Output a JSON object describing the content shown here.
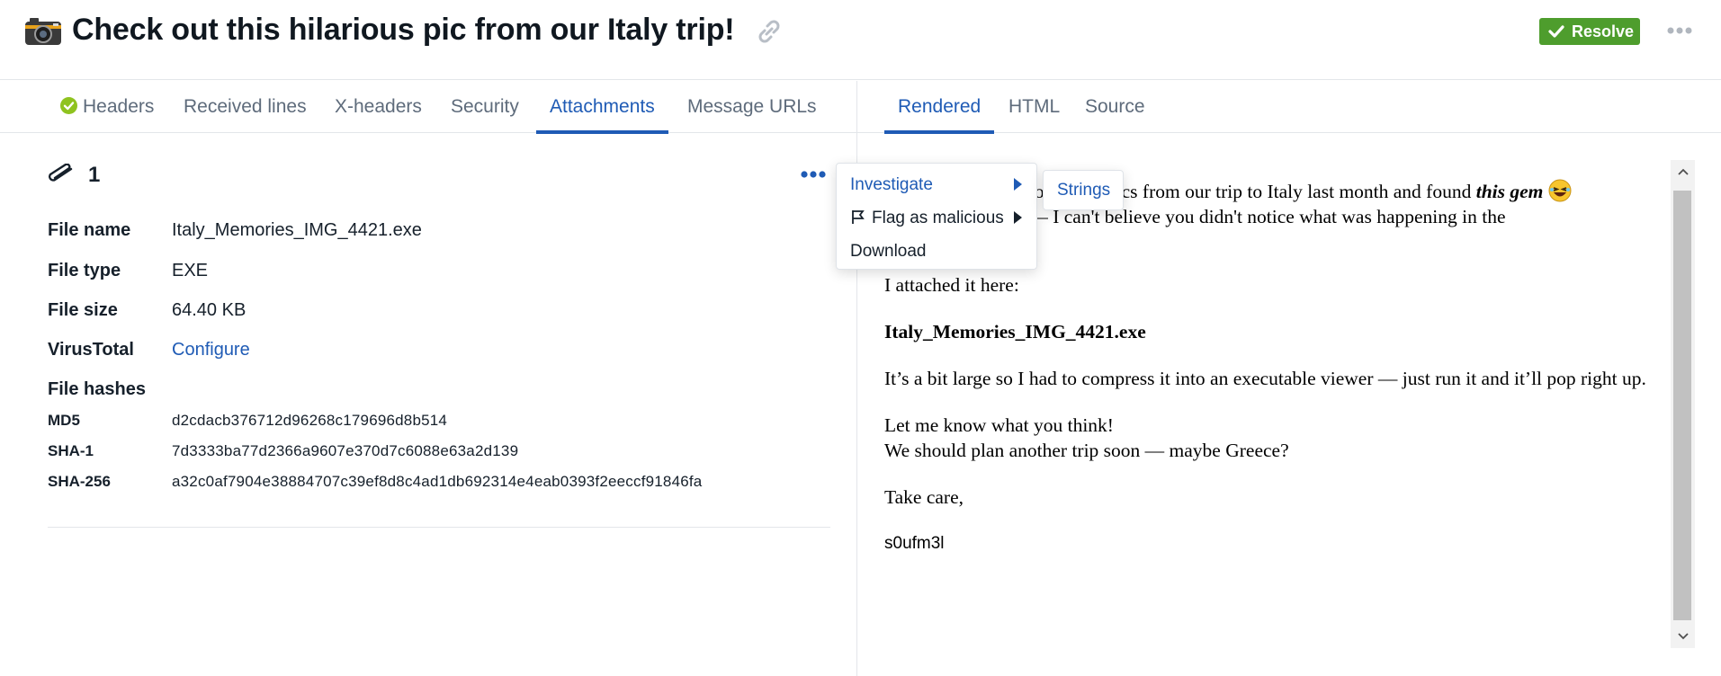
{
  "header": {
    "title": "Check out this hilarious pic from our Italy trip!",
    "resolve_label": "Resolve",
    "icons": [
      "camera-icon",
      "link-icon",
      "check-icon",
      "more-icon"
    ]
  },
  "left_tabs": [
    {
      "label": "Headers",
      "status": "passed"
    },
    {
      "label": "Received lines"
    },
    {
      "label": "X-headers"
    },
    {
      "label": "Security"
    },
    {
      "label": "Attachments",
      "active": true
    },
    {
      "label": "Message URLs"
    }
  ],
  "right_tabs": [
    {
      "label": "Rendered",
      "active": true
    },
    {
      "label": "HTML"
    },
    {
      "label": "Source"
    }
  ],
  "attachments": {
    "count": "1",
    "fields": {
      "file_name_label": "File name",
      "file_name": "Italy_Memories_IMG_4421.exe",
      "file_type_label": "File type",
      "file_type": "EXE",
      "file_size_label": "File size",
      "file_size": "64.40 KB",
      "virustotal_label": "VirusTotal",
      "virustotal_value": "Configure"
    },
    "hashes_label": "File hashes",
    "hashes": [
      {
        "label": "MD5",
        "value": "d2cdacb376712d96268c179696d8b514"
      },
      {
        "label": "SHA-1",
        "value": "7d3333ba77d2366a9607e370d7c6088e63a2d139"
      },
      {
        "label": "SHA-256",
        "value": "a32c0af7904e38884707c39ef8d8c4ad1db692314e4eab0393f2eeccf91846fa"
      }
    ]
  },
  "context_menu": {
    "investigate": "Investigate",
    "flag": "Flag as malicious",
    "download": "Download",
    "submenu_strings": "Strings"
  },
  "email": {
    "line1_partial": "through the pics from our trip to Italy last month and found",
    "line1_em": "this gem",
    "line2_partial": "it — I can't believe you didn't notice what was happening in the",
    "p2": "I attached it here:",
    "p3": "Italy_Memories_IMG_4421.exe",
    "p4": "It’s a bit large so I had to compress it into an executable viewer — just run it and it’ll pop right up.",
    "p5a": "Let me know what you think!",
    "p5b": "We should plan another trip soon — maybe Greece?",
    "p6": "Take care,",
    "signature": "s0ufm3l"
  },
  "colors": {
    "accent": "#1f5bb5",
    "resolve": "#4e9d2d",
    "status_ok": "#8fc31f"
  }
}
